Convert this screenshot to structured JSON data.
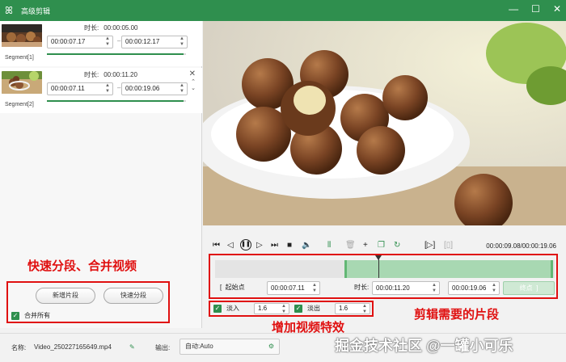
{
  "window": {
    "title": "高级剪辑",
    "minimize": "—",
    "maximize": "☐",
    "close": "✕"
  },
  "segments": [
    {
      "label": "Segment[1]",
      "duration_label": "时长:",
      "duration": "00:00:05.00",
      "start": "00:00:07.17",
      "end": "00:00:12.17",
      "progress": 0.98
    },
    {
      "label": "Segment[2]",
      "duration_label": "时长:",
      "duration": "00:00:11.20",
      "start": "00:00:07.11",
      "end": "00:00:19.06",
      "progress": 0.98
    }
  ],
  "buttons": {
    "add_segment": "新增片段",
    "quick_split": "快速分段",
    "merge_all": "合并所有"
  },
  "annotations": {
    "left": "快速分段、合并视频",
    "effects": "增加视频特效",
    "clip": "剪辑需要的片段"
  },
  "player": {
    "current_time": "00:00:09.08/00:00:19.06"
  },
  "range": {
    "start_label": "起始点",
    "start": "00:00:07.11",
    "duration_label": "时长:",
    "duration": "00:00:11.20",
    "end": "00:00:19.06",
    "end_btn": "终点"
  },
  "effects": {
    "fade_in_label": "淡入",
    "fade_in": "1.6",
    "fade_out_label": "淡出",
    "fade_out": "1.6"
  },
  "bottom": {
    "name_label": "名称:",
    "name": "Video_250227165649.mp4",
    "output_label": "输出:",
    "output": "自动:Auto"
  },
  "watermark": "掘金技术社区 @一罐小可乐",
  "colors": {
    "accent": "#2f8f4e",
    "annotation": "#e01010",
    "selection": "#a8d8b2"
  }
}
